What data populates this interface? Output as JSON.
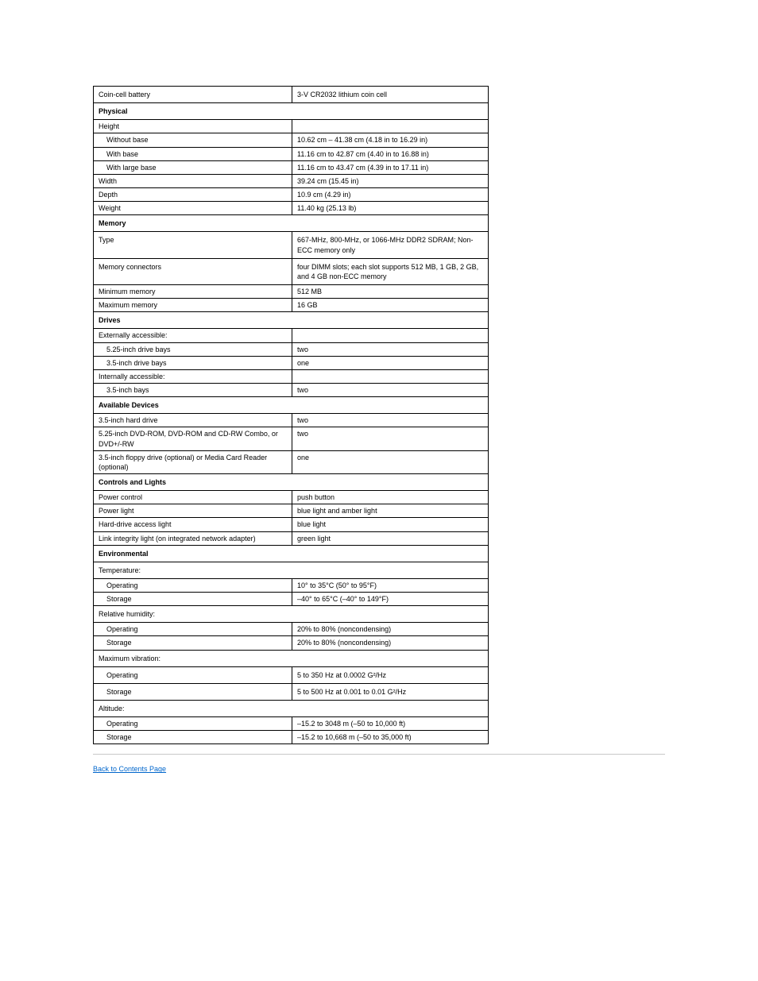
{
  "rows": [
    {
      "type": "row",
      "cls": "",
      "label": "Coin-cell battery",
      "value": "3-V CR2032 lithium coin cell"
    },
    {
      "type": "section",
      "text": "Physical"
    },
    {
      "type": "row",
      "cls": "tight",
      "label": "Height",
      "value": ""
    },
    {
      "type": "row",
      "cls": "tight",
      "label": "    Without base",
      "value": "10.62 cm – 41.38 cm (4.18 in to 16.29 in)"
    },
    {
      "type": "row",
      "cls": "tight",
      "label": "    With base",
      "value": "11.16 cm to 42.87 cm (4.40 in to 16.88 in)"
    },
    {
      "type": "row",
      "cls": "tight",
      "label": "    With large base",
      "value": "11.16 cm to 43.47 cm (4.39 in to 17.11 in)"
    },
    {
      "type": "row",
      "cls": "tight",
      "label": "Width",
      "value": "39.24 cm (15.45 in)"
    },
    {
      "type": "row",
      "cls": "tight",
      "label": "Depth",
      "value": "10.9 cm (4.29 in)"
    },
    {
      "type": "row",
      "cls": "tight",
      "label": "Weight",
      "value": "11.40 kg (25.13 lb)"
    },
    {
      "type": "section",
      "text": "Memory"
    },
    {
      "type": "row",
      "cls": "",
      "label": "Type",
      "value": "667-MHz, 800-MHz, or 1066-MHz DDR2 SDRAM; Non-ECC memory only"
    },
    {
      "type": "row",
      "cls": "",
      "label": "Memory connectors",
      "value": "four DIMM slots; each slot supports 512 MB, 1 GB, 2 GB, and 4 GB non-ECC memory"
    },
    {
      "type": "row",
      "cls": "tight",
      "label": "Minimum memory",
      "value": "512 MB"
    },
    {
      "type": "row",
      "cls": "tight",
      "label": "Maximum memory",
      "value": "16 GB"
    },
    {
      "type": "section",
      "text": "Drives"
    },
    {
      "type": "row",
      "cls": "tight",
      "label": "Externally accessible:",
      "value": ""
    },
    {
      "type": "row",
      "cls": "tight",
      "label": "    5.25-inch drive bays",
      "value": "two"
    },
    {
      "type": "row",
      "cls": "tight",
      "label": "    3.5-inch drive bays",
      "value": "one"
    },
    {
      "type": "row",
      "cls": "tight",
      "label": "Internally accessible:",
      "value": ""
    },
    {
      "type": "row",
      "cls": "tight",
      "label": "    3.5-inch bays",
      "value": "two"
    },
    {
      "type": "section",
      "text": "Available Devices"
    },
    {
      "type": "row",
      "cls": "tight",
      "label": "3.5-inch hard drive",
      "value": "two"
    },
    {
      "type": "row",
      "cls": "tight",
      "label": "5.25-inch DVD-ROM, DVD-ROM and CD-RW Combo, or DVD+/-RW",
      "value": "two"
    },
    {
      "type": "row",
      "cls": "tight",
      "label": "3.5-inch floppy drive (optional) or Media Card Reader (optional)",
      "value": "one"
    },
    {
      "type": "section",
      "text": "Controls and Lights"
    },
    {
      "type": "row",
      "cls": "tight",
      "label": "Power control",
      "value": "push button"
    },
    {
      "type": "row",
      "cls": "tight",
      "label": "Power light",
      "value": "blue light and amber light"
    },
    {
      "type": "row",
      "cls": "tight",
      "label": "Hard-drive access light",
      "value": "blue light"
    },
    {
      "type": "row",
      "cls": "tight",
      "label": "Link integrity light (on integrated network adapter)",
      "value": "green light"
    },
    {
      "type": "section",
      "text": "Environmental"
    },
    {
      "type": "subhead",
      "text": "Temperature:"
    },
    {
      "type": "row",
      "cls": "tight",
      "label": "    Operating",
      "value": "10° to 35°C (50° to 95°F)"
    },
    {
      "type": "row",
      "cls": "tight",
      "label": "    Storage",
      "value": "–40° to 65°C (–40° to 149°F)"
    },
    {
      "type": "subhead",
      "text": "Relative humidity:"
    },
    {
      "type": "row",
      "cls": "tight",
      "label": "    Operating",
      "value": "20% to 80% (noncondensing)"
    },
    {
      "type": "row",
      "cls": "tight",
      "label": "    Storage",
      "value": "20% to 80% (noncondensing)"
    },
    {
      "type": "subhead",
      "text": "Maximum vibration:"
    },
    {
      "type": "row",
      "cls": "",
      "label": "    Operating",
      "value": "5 to 350 Hz at 0.0002 G²/Hz"
    },
    {
      "type": "row",
      "cls": "",
      "label": "    Storage",
      "value": "5 to 500 Hz at 0.001 to 0.01 G²/Hz"
    },
    {
      "type": "subhead",
      "text": "Altitude:"
    },
    {
      "type": "row",
      "cls": "tight",
      "label": "    Operating",
      "value": "–15.2 to 3048 m (–50 to 10,000 ft)"
    },
    {
      "type": "row",
      "cls": "tight",
      "label": "    Storage",
      "value": "–15.2 to 10,668 m (–50 to 35,000 ft)"
    }
  ],
  "back_link": "Back to Contents Page"
}
